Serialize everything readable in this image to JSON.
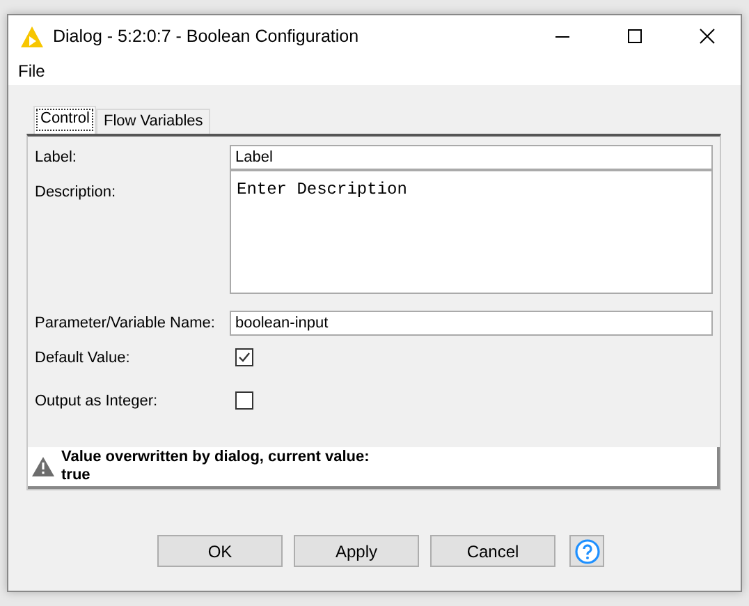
{
  "window": {
    "title": "Dialog - 5:2:0:7 - Boolean Configuration"
  },
  "menu": [
    "File"
  ],
  "tabs": [
    {
      "label": "Control",
      "selected": true
    },
    {
      "label": "Flow Variables",
      "selected": false
    }
  ],
  "fields": [
    {
      "kind": "text",
      "label": "Label:",
      "value": "Label"
    },
    {
      "kind": "textarea",
      "label": "Description:",
      "value": "Enter Description"
    },
    {
      "kind": "text",
      "label": "Parameter/Variable Name:",
      "value": "boolean-input"
    },
    {
      "kind": "checkbox",
      "label": "Default Value:",
      "checked": true
    },
    {
      "kind": "checkbox",
      "label": "Output as Integer:",
      "checked": false
    }
  ],
  "warning": {
    "lines": [
      "Value overwritten by dialog, current value:",
      "true"
    ]
  },
  "buttons": [
    "OK",
    "Apply",
    "Cancel"
  ]
}
